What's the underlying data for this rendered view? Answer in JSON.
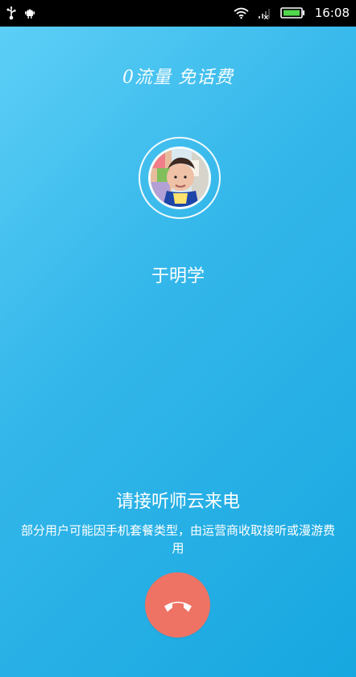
{
  "status_bar": {
    "time": "16:08",
    "icons": {
      "left": [
        "usb-icon",
        "android-debug-icon"
      ],
      "right": [
        "wifi-icon",
        "signal-icon",
        "battery-icon"
      ]
    }
  },
  "call": {
    "promo_text": "0流量 免话费",
    "caller_name": "于明学",
    "incoming_title": "请接听师云来电",
    "incoming_note": "部分用户可能因手机套餐类型，由运营商收取接听或漫游费用"
  },
  "colors": {
    "background_start": "#5fd0f7",
    "background_end": "#17a7e0",
    "hangup_button": "#ee7365"
  }
}
